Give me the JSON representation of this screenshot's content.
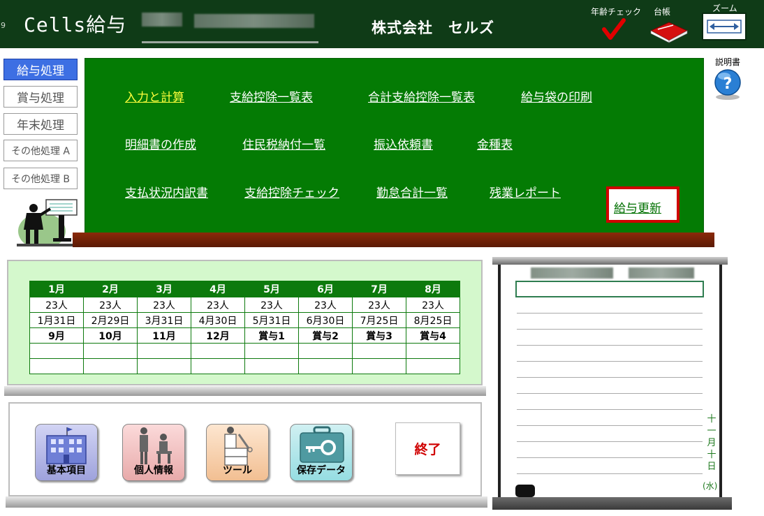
{
  "header": {
    "row_number": "9",
    "app_title": "Cells給与",
    "company": "株式会社　セルズ",
    "age_check_label": "年齢チェック",
    "ledger_label": "台帳",
    "zoom_label": "ズーム"
  },
  "nav": {
    "kyuyo": "給与処理",
    "shoyo": "賞与処理",
    "nenmatsu": "年末処理",
    "other_a": "その他処理 A",
    "other_b": "その他処理 B"
  },
  "manual_label": "説明書",
  "board_menu": [
    "入力と計算",
    "支給控除一覧表",
    "合計支給控除一覧表",
    "給与袋の印刷",
    "明細書の作成",
    "住民税納付一覧",
    "振込依頼書",
    "金種表",
    "支払状況内訳書",
    "支給控除チェック",
    "勤怠合計一覧",
    "残業レポート"
  ],
  "update_label": "給与更新",
  "calendar": {
    "months": [
      "1月",
      "2月",
      "3月",
      "4月",
      "5月",
      "6月",
      "7月",
      "8月"
    ],
    "counts": [
      "23人",
      "23人",
      "23人",
      "23人",
      "23人",
      "23人",
      "23人",
      "23人"
    ],
    "dates": [
      "1月31日",
      "2月29日",
      "3月31日",
      "4月30日",
      "5月31日",
      "6月30日",
      "7月25日",
      "8月25日"
    ],
    "months2": [
      "9月",
      "10月",
      "11月",
      "12月",
      "賞与1",
      "賞与2",
      "賞与3",
      "賞与4"
    ]
  },
  "tools": {
    "basic": "基本項目",
    "personal": "個人情報",
    "tool": "ツール",
    "save": "保存データ",
    "exit": "終了"
  },
  "memo": {
    "date_chars": [
      "十",
      "一",
      "月",
      "十",
      "日"
    ],
    "weekday": "(水)"
  },
  "colors": {
    "header_bg": "#0f3b17",
    "board_green": "#047b04",
    "nav_active": "#3d6fe3",
    "highlight_red": "#d00000",
    "active_menu_yellow": "#ffff3c"
  }
}
